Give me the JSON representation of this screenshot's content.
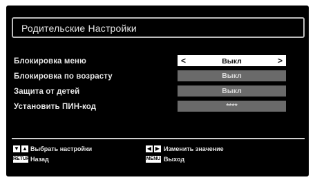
{
  "window": {
    "title": "Родительские Настройки"
  },
  "settings": [
    {
      "label": "Блокировка меню",
      "value": "Выкл",
      "selected": true,
      "left_arrow": "<",
      "right_arrow": ">"
    },
    {
      "label": "Блокировка по возрасту",
      "value": "Выкл"
    },
    {
      "label": "Защита от детей",
      "value": "Выкл"
    },
    {
      "label": "Установить ПИН-код",
      "value": "****"
    }
  ],
  "footer": {
    "hints": [
      {
        "key_label": "▼▲",
        "text": "Выбрать настройки"
      },
      {
        "key_label": "RETURN",
        "text": "Назад"
      },
      {
        "key_label": "◀▶",
        "text": "Изменить значение"
      },
      {
        "key_label": "MENU",
        "text": "Выход"
      }
    ]
  },
  "icons": {
    "up_down": "up-down-arrows-icon",
    "left_right": "left-right-arrows-icon"
  },
  "colors": {
    "background": "#000000",
    "selected_value": "#ffffff",
    "unselected_value": "#6a6a6a",
    "text": "#e6e6e6"
  }
}
